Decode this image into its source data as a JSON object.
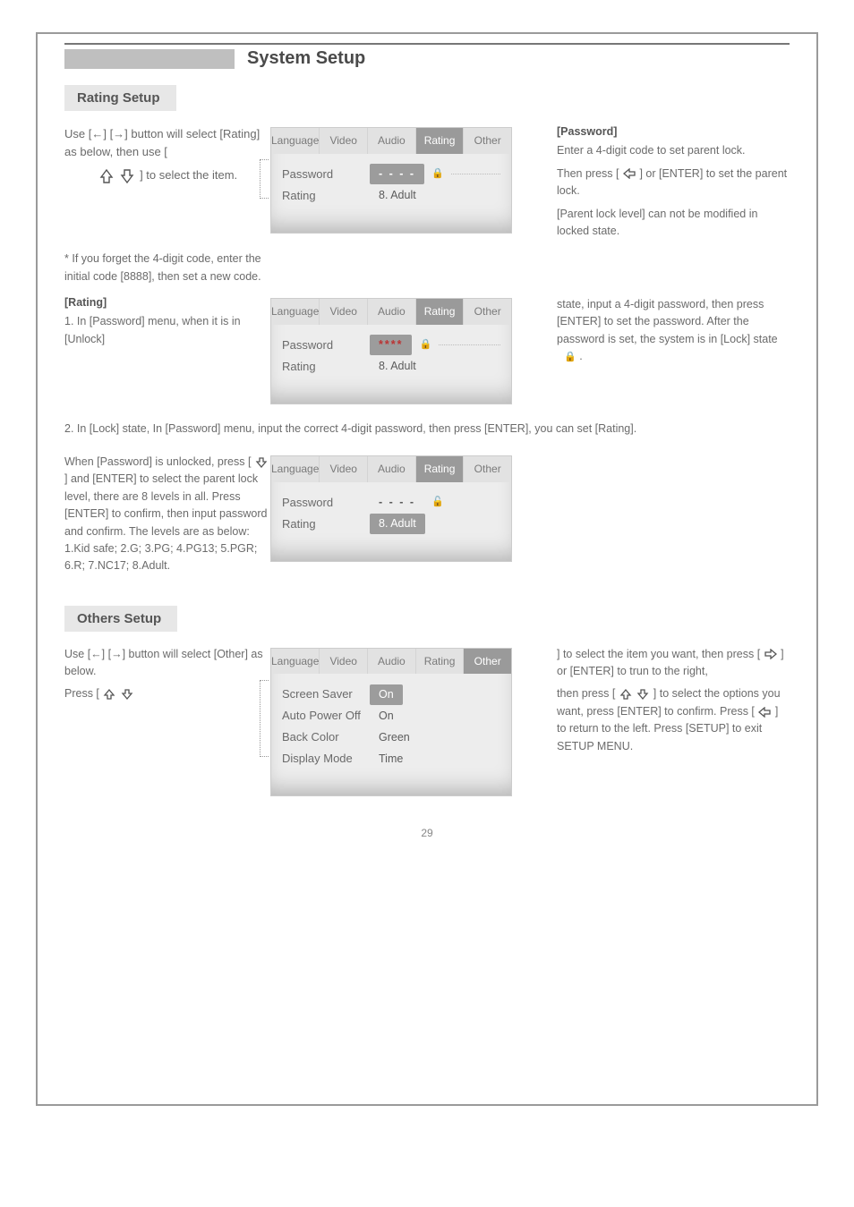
{
  "header": {
    "title": "System Setup"
  },
  "sections": {
    "rating": {
      "pill": "Rating Setup",
      "intro": "Use [←] [→] button will select [Rating] as below, then use [",
      "intro_tail": "] to select the item.",
      "password_label": "[Password]",
      "password_line1": "Enter a 4-digit code to set parent lock.",
      "password_line2_a": "Then press [",
      "password_line2_b": "] or [",
      "password_line2_c": "] to set the parent lock.",
      "password_line3": "[Parent lock level] can not be modified in locked state.",
      "note_label": "*",
      "note_line1": "If you forget the 4-digit code, enter the initial code [8888], then set a new code.",
      "rating_label": "[Rating]",
      "step1_head": "1. In [Password] menu, when it is in [Unlock]",
      "step1_body_a": "state, input a 4-digit password, then press [ENTER] to set the password. After the password is set, the system is in [Lock] state",
      "step1_body_b": ".",
      "step2_head": "2. In [Lock] state, In [Password] menu, input the correct 4-digit password, then press [ENTER], you can set [Rating].",
      "step3_body_a": "When [Password] is unlocked, press [",
      "step3_body_b": "] and [ENTER] to select the parent lock level, there are 8 levels in all. Press [ENTER] to confirm, then input password and confirm. The levels are as below: 1.Kid safe; 2.G; 3.PG; 4.PG13; 5.PGR; 6.R; 7.NC17; 8.Adult."
    },
    "others": {
      "pill": "Others Setup",
      "intro_a": "Use [←] [→] button will select [Other] as below.",
      "intro_b": "Press [",
      "intro_c": "] to select the item you want, then press [",
      "intro_d": "] or [ENTER] to trun to the right,",
      "intro_e": "then press [",
      "intro_f": "] to select the options you want, press [ENTER] to confirm. Press [",
      "intro_g": "] to return to the left. Press [SETUP] to exit SETUP MENU."
    }
  },
  "osd": {
    "tabs": [
      "Language",
      "Video",
      "Audio",
      "Rating",
      "Other"
    ],
    "rating_rows": {
      "password": "Password",
      "rating": "Rating",
      "pw_masked_dashes": "- - - -",
      "pw_masked_stars": "****",
      "rating_value": "8. Adult"
    },
    "other_rows": {
      "screen_saver": "Screen Saver",
      "auto_power_off": "Auto Power Off",
      "back_color": "Back Color",
      "display_mode": "Display Mode",
      "on": "On",
      "green": "Green",
      "time": "Time"
    }
  },
  "icons": {
    "lock_closed": "🔒",
    "lock_open": "🔓"
  },
  "page_number": "29"
}
